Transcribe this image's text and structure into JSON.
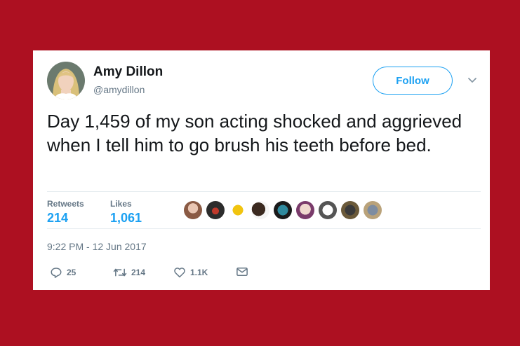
{
  "author": {
    "name": "Amy Dillon",
    "handle": "@amydillon"
  },
  "follow_label": "Follow",
  "tweet": {
    "text": "Day 1,459 of my son acting shocked and aggrieved when I tell him to go brush his teeth before bed."
  },
  "stats": {
    "retweets_label": "Retweets",
    "retweets_value": "214",
    "likes_label": "Likes",
    "likes_value": "1,061"
  },
  "liker_avatars": [
    "liker-1",
    "liker-2",
    "liker-3",
    "liker-4",
    "liker-5",
    "liker-6",
    "liker-7",
    "liker-8",
    "liker-9",
    "liker-10"
  ],
  "timestamp": "9:22 PM - 12 Jun 2017",
  "actions": {
    "reply_count": "25",
    "retweet_count": "214",
    "like_count": "1.1K"
  },
  "colors": {
    "background": "#ad1021",
    "accent": "#1da1f2",
    "secondary_text": "#657786"
  }
}
